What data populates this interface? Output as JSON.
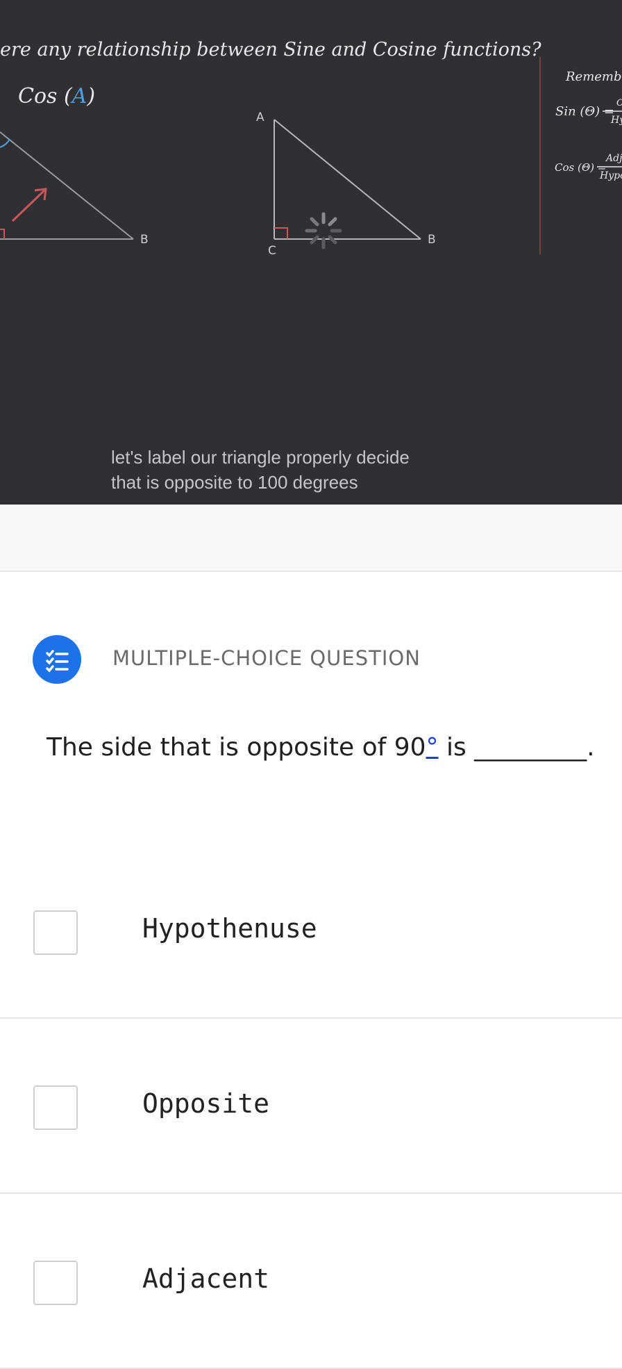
{
  "video": {
    "board_title": "ere any relationship between Sine and Cosine functions?",
    "left_formula": "Cos (A)",
    "left_formula_prefix": "Cos (",
    "left_formula_var": "A",
    "left_formula_suffix": ")",
    "left_vertex_b": "B",
    "right_vertex_a": "A",
    "right_vertex_b": "B",
    "right_vertex_c": "C",
    "remember_label": "Remember",
    "sin_formula": "Sin (Θ) =",
    "cos_formula": "Cos (Θ) =",
    "sin_frac_num": "O",
    "sin_frac_den": "Hy",
    "cos_frac_num": "Adj",
    "cos_frac_den": "Hypo",
    "subtitle_line1": "let's label our triangle properly decide",
    "subtitle_line2": "that is opposite to 100 degrees",
    "colors": {
      "board_bg": "#303033",
      "remember_red": "#c84a4f",
      "accent_blue": "#4aa0e8",
      "arrow_red": "#c9555f"
    }
  },
  "question": {
    "type_label": "MULTIPLE-CHOICE QUESTION",
    "icon": "checklist-icon",
    "text_before": "The side that is opposite of 90",
    "degree_symbol": "°",
    "text_after": " is _________.",
    "choices": [
      {
        "label": "Hypothenuse",
        "checked": false
      },
      {
        "label": "Opposite",
        "checked": false
      },
      {
        "label": "Adjacent",
        "checked": false
      }
    ],
    "accent_color": "#1d72e8"
  }
}
